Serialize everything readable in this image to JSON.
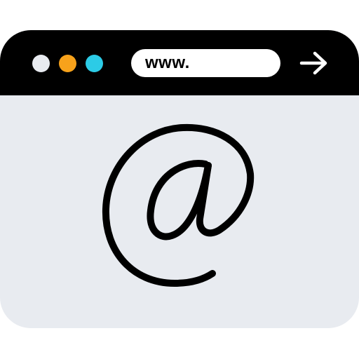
{
  "window": {
    "titlebar_color": "#000000",
    "content_color": "#e8ebf0"
  },
  "titlebar": {
    "dots": [
      {
        "color": "#e8ebf0"
      },
      {
        "color": "#f7a21b"
      },
      {
        "color": "#2ccbe6"
      }
    ],
    "url": {
      "value": "www."
    },
    "go_icon": "arrow-right-icon"
  },
  "content": {
    "icon": "at-sign-icon"
  }
}
